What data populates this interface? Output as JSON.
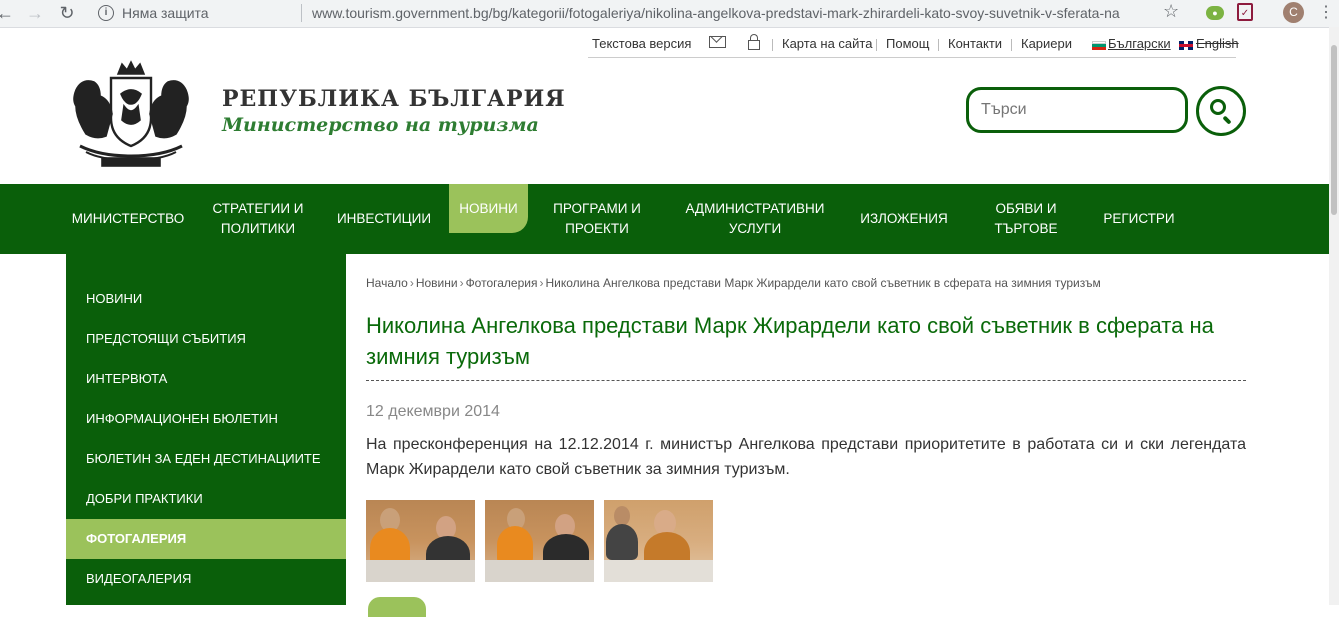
{
  "browser": {
    "security_label": "Няма защита",
    "url": "www.tourism.government.bg/bg/kategorii/fotogaleriya/nikolina-angelkova-predstavi-mark-zhirardeli-kato-svoy-suvetnik-v-sferata-na",
    "profile_initial": "C"
  },
  "toplinks": {
    "text_version": "Текстова версия",
    "sitemap": "Карта на сайта",
    "help": "Помощ",
    "contacts": "Контакти",
    "careers": "Кариери",
    "lang_bg": "Български",
    "lang_en": "English"
  },
  "logo": {
    "title": "РЕПУБЛИКА БЪЛГАРИЯ",
    "subtitle": "Министерство на туризма"
  },
  "search": {
    "placeholder": "Търси"
  },
  "mainnav": [
    {
      "label": "МИНИСТЕРСТВО"
    },
    {
      "label": "СТРАТЕГИИ И ПОЛИТИКИ"
    },
    {
      "label": "ИНВЕСТИЦИИ"
    },
    {
      "label": "НОВИНИ"
    },
    {
      "label": "ПРОГРАМИ И ПРОЕКТИ"
    },
    {
      "label": "АДМИНИСТРАТИВНИ УСЛУГИ"
    },
    {
      "label": "ИЗЛОЖЕНИЯ"
    },
    {
      "label": "ОБЯВИ И ТЪРГОВЕ"
    },
    {
      "label": "РЕГИСТРИ"
    }
  ],
  "sidebar": [
    {
      "label": "НОВИНИ"
    },
    {
      "label": "ПРЕДСТОЯЩИ СЪБИТИЯ"
    },
    {
      "label": "ИНТЕРВЮТА"
    },
    {
      "label": "ИНФОРМАЦИОНЕН БЮЛЕТИН"
    },
    {
      "label": "БЮЛЕТИН ЗА ЕДЕН ДЕСТИНАЦИИТЕ"
    },
    {
      "label": "ДОБРИ ПРАКТИКИ"
    },
    {
      "label": "ФОТОГАЛЕРИЯ"
    },
    {
      "label": "ВИДЕОГАЛЕРИЯ"
    }
  ],
  "breadcrumb": [
    "Начало",
    "Новини",
    "Фотогалерия",
    "Николина Ангелкова представи Марк Жирардели като свой съветник в сферата на зимния туризъм"
  ],
  "article": {
    "title": "Николина Ангелкова представи Марк Жирардели като свой съветник в сферата на зимния туризъм",
    "date": "12 декември 2014",
    "body": "На пресконференция на 12.12.2014 г. министър Ангелкова представи приоритетите в работата си и ски легендата Марк Жирардели като свой съветник за зимния туризъм."
  },
  "colors": {
    "brand_green": "#0a5f0a",
    "active_green": "#9bc25b",
    "title_green": "#0a6a0a"
  }
}
